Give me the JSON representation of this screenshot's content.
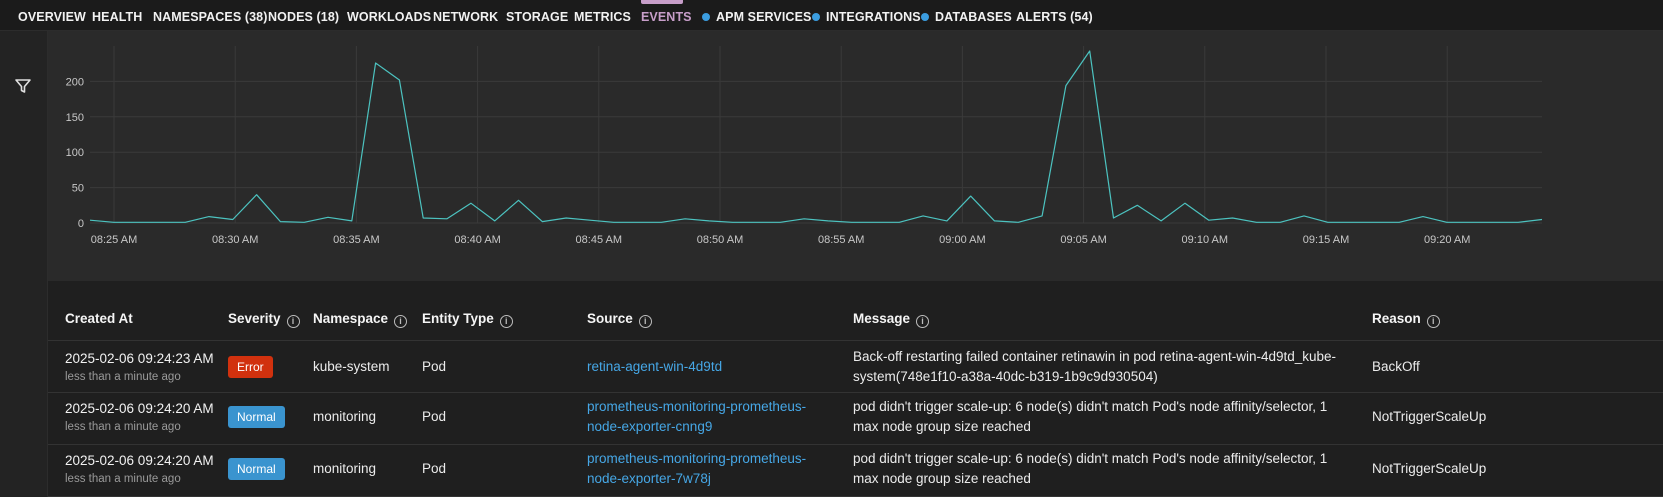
{
  "nav": {
    "tabs": [
      {
        "label": "OVERVIEW",
        "dot": false
      },
      {
        "label": "HEALTH",
        "dot": false
      },
      {
        "label": "NAMESPACES (38)",
        "dot": false
      },
      {
        "label": "NODES (18)",
        "dot": false
      },
      {
        "label": "WORKLOADS",
        "dot": false
      },
      {
        "label": "NETWORK",
        "dot": false
      },
      {
        "label": "STORAGE",
        "dot": false
      },
      {
        "label": "METRICS",
        "dot": false
      },
      {
        "label": "EVENTS",
        "dot": false,
        "active": true
      },
      {
        "label": "APM SERVICES",
        "dot": true
      },
      {
        "label": "INTEGRATIONS",
        "dot": true
      },
      {
        "label": "DATABASES",
        "dot": true
      },
      {
        "label": "ALERTS (54)",
        "dot": false
      }
    ]
  },
  "colors": {
    "active_tab": "#c79ec9",
    "line": "#4cc3c0",
    "link": "#46a7e6",
    "error_badge": "#d1310e",
    "normal_badge": "#3a94cf",
    "dot": "#3b9de0"
  },
  "chart_data": {
    "type": "line",
    "x_ticks": [
      "08:25 AM",
      "08:30 AM",
      "08:35 AM",
      "08:40 AM",
      "08:45 AM",
      "08:50 AM",
      "08:55 AM",
      "09:00 AM",
      "09:05 AM",
      "09:10 AM",
      "09:15 AM",
      "09:20 AM"
    ],
    "y_ticks": [
      0,
      50,
      100,
      150,
      200
    ],
    "ylim": [
      0,
      250
    ],
    "grid": true,
    "series": [
      {
        "values": [
          4,
          1,
          1,
          1,
          1,
          9,
          5,
          40,
          2,
          1,
          8,
          3,
          226,
          202,
          7,
          6,
          28,
          3,
          32,
          2,
          7,
          4,
          1,
          1,
          1,
          6,
          3,
          1,
          1,
          1,
          6,
          3,
          1,
          1,
          1,
          10,
          3,
          38,
          3,
          1,
          10,
          194,
          243,
          7,
          25,
          3,
          28,
          4,
          7,
          1,
          1,
          10,
          1,
          1,
          1,
          1,
          9,
          1,
          1,
          1,
          1,
          5
        ]
      }
    ]
  },
  "table": {
    "headers": [
      "Created At",
      "Severity",
      "Namespace",
      "Entity Type",
      "Source",
      "Message",
      "Reason"
    ],
    "info_icon": "i",
    "rows": [
      {
        "created": "2025-02-06 09:24:23 AM",
        "created_rel": "less than a minute ago",
        "severity": "Error",
        "severity_kind": "error",
        "namespace": "kube-system",
        "entity": "Pod",
        "source": "retina-agent-win-4d9td",
        "message": "Back-off restarting failed container retinawin in pod retina-agent-win-4d9td_kube-system(748e1f10-a38a-40dc-b319-1b9c9d930504)",
        "reason": "BackOff"
      },
      {
        "created": "2025-02-06 09:24:20 AM",
        "created_rel": "less than a minute ago",
        "severity": "Normal",
        "severity_kind": "normal",
        "namespace": "monitoring",
        "entity": "Pod",
        "source": "prometheus-monitoring-prometheus-node-exporter-cnng9",
        "message": "pod didn't trigger scale-up: 6 node(s) didn't match Pod's node affinity/selector, 1 max node group size reached",
        "reason": "NotTriggerScaleUp"
      },
      {
        "created": "2025-02-06 09:24:20 AM",
        "created_rel": "less than a minute ago",
        "severity": "Normal",
        "severity_kind": "normal",
        "namespace": "monitoring",
        "entity": "Pod",
        "source": "prometheus-monitoring-prometheus-node-exporter-7w78j",
        "message": "pod didn't trigger scale-up: 6 node(s) didn't match Pod's node affinity/selector, 1 max node group size reached",
        "reason": "NotTriggerScaleUp"
      }
    ]
  }
}
